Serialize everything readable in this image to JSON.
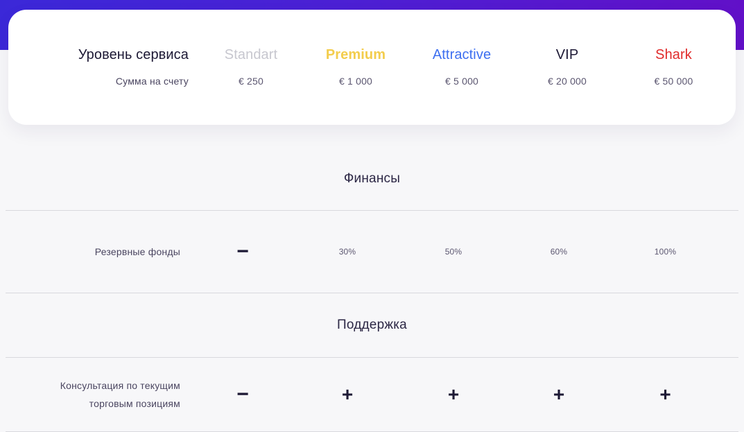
{
  "theme": {
    "band_gradient_from": "#3b28d8",
    "band_gradient_to": "#6210c8",
    "page_background": "#f7f7f9",
    "card_background": "#ffffff",
    "text_primary": "#1d1935",
    "text_secondary": "#5b5670",
    "divider": "#d9d9de"
  },
  "header": {
    "tier_label": "Уровень сервиса",
    "balance_label": "Сумма на счету",
    "plans": [
      {
        "name": "Standart",
        "amount": "€ 250",
        "color": "#c7c7cf"
      },
      {
        "name": "Premium",
        "amount": "€ 1 000",
        "color": "#f3cd4d"
      },
      {
        "name": "Attractive",
        "amount": "€ 5 000",
        "color": "#3d6ff0"
      },
      {
        "name": "VIP",
        "amount": "€ 20 000",
        "color": "#1d1935"
      },
      {
        "name": "Shark",
        "amount": "€ 50 000",
        "color": "#e02b2b"
      }
    ]
  },
  "sections": [
    {
      "title": "Финансы",
      "rows": [
        {
          "label": "Резервные фонды",
          "values": [
            "−",
            "30%",
            "50%",
            "60%",
            "100%"
          ],
          "kinds": [
            "mark-minus",
            "text",
            "text",
            "text",
            "text"
          ]
        }
      ]
    },
    {
      "title": "Поддержка",
      "rows": [
        {
          "label_line1": "Консультация по текущим",
          "label_line2": "торговым позициям",
          "values": [
            "−",
            "+",
            "+",
            "+",
            "+"
          ],
          "kinds": [
            "mark-minus",
            "mark-plus",
            "mark-plus",
            "mark-plus",
            "mark-plus"
          ]
        }
      ]
    }
  ]
}
